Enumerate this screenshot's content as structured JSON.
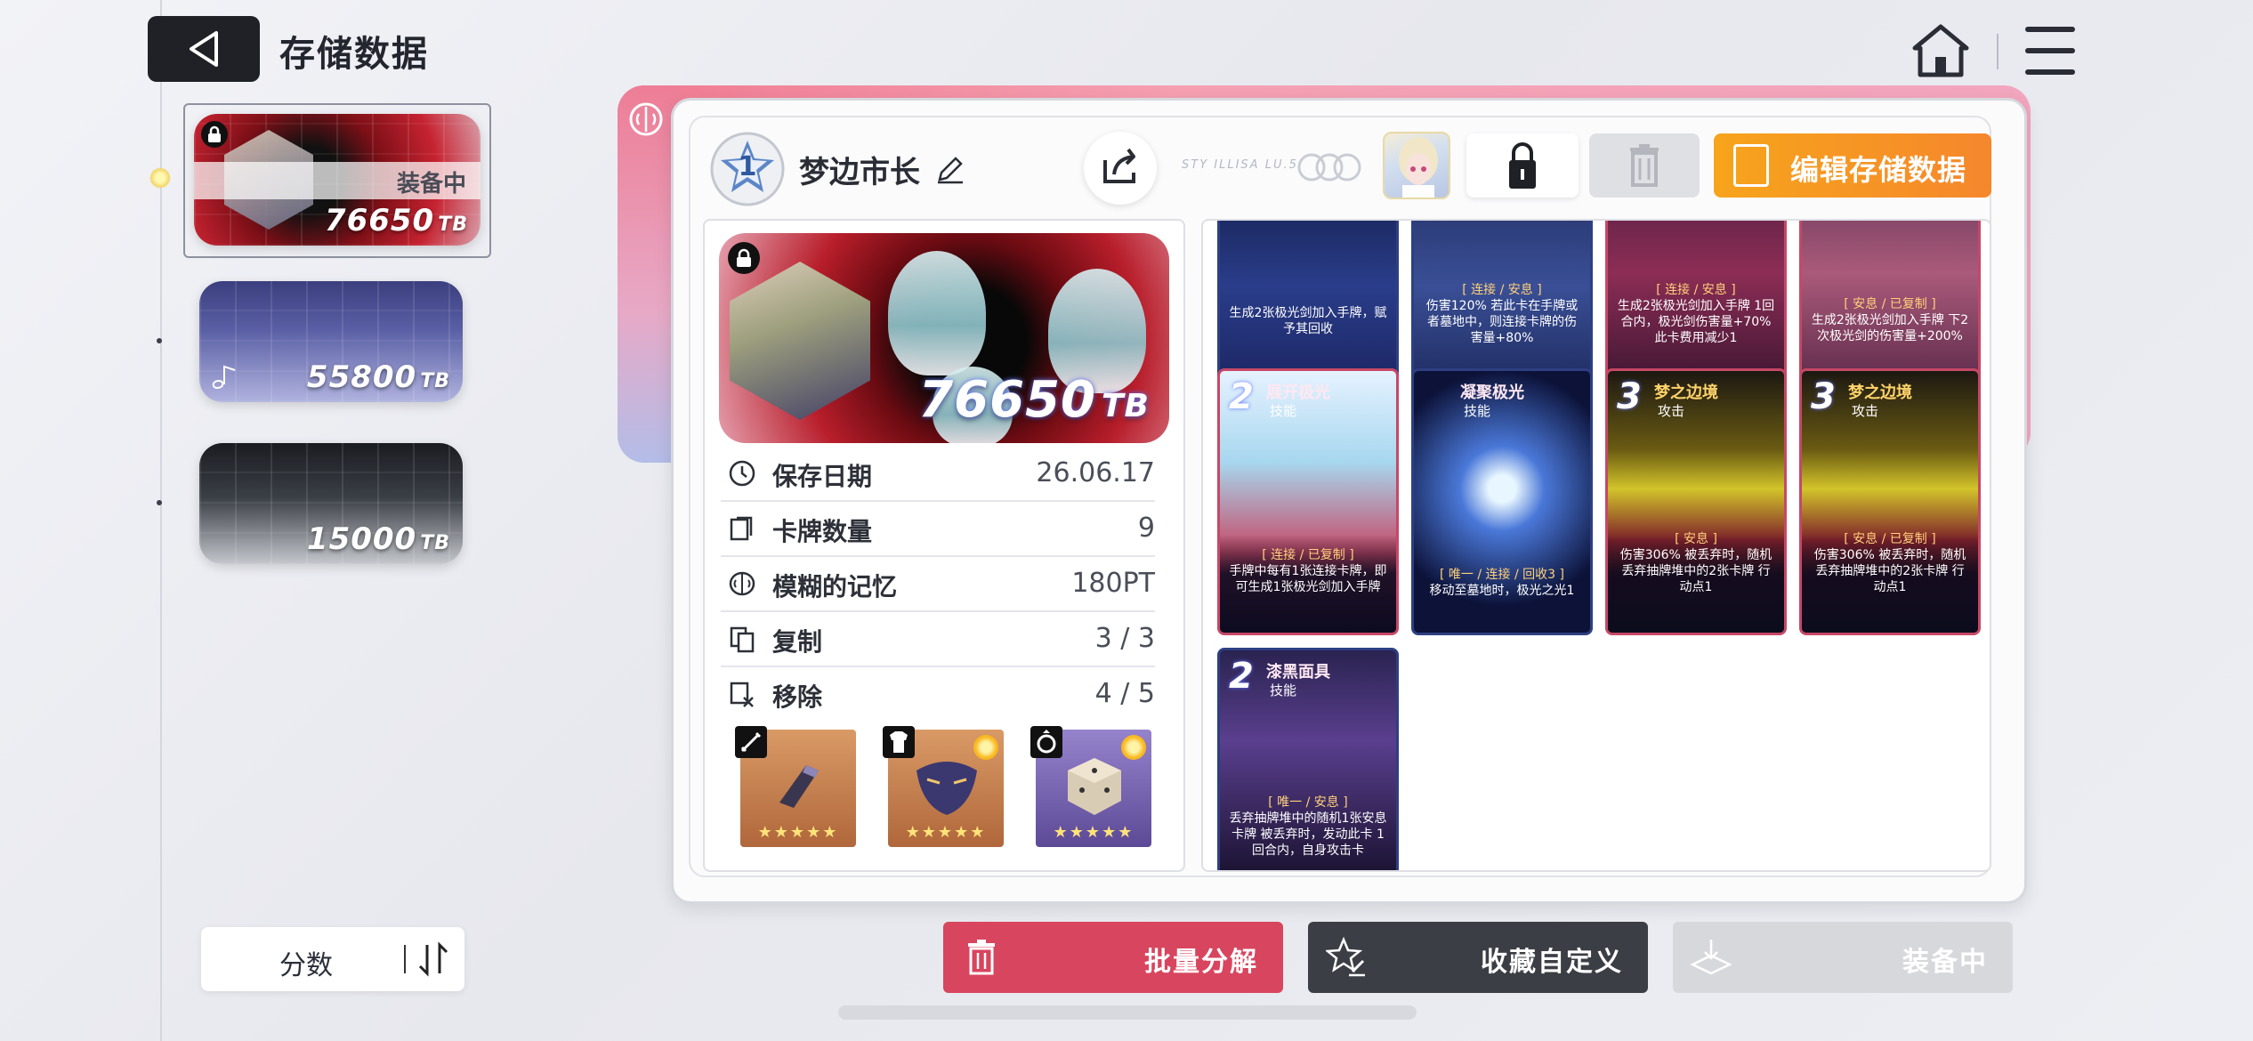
{
  "header": {
    "title": "存储数据",
    "back_icon": "back-triangle-icon",
    "home_icon": "home-icon",
    "menu_icon": "menu-icon"
  },
  "sidebar": {
    "slots": [
      {
        "value": "76650",
        "unit": "TB",
        "equipped_label": "装备中",
        "locked": true,
        "selected": true
      },
      {
        "value": "55800",
        "unit": "TB",
        "locked": false
      },
      {
        "value": "15000",
        "unit": "TB",
        "locked": false
      }
    ],
    "sort": {
      "label": "分数"
    }
  },
  "profile": {
    "level": "1",
    "name": "梦边市长",
    "serial": "STY ILLISA LU.5"
  },
  "toolbar": {
    "edit_save_label": "编辑存储数据"
  },
  "hero": {
    "value": "76650",
    "unit": "TB"
  },
  "stats": [
    {
      "label": "保存日期",
      "value": "26.06.17",
      "icon": "clock-icon"
    },
    {
      "label": "卡牌数量",
      "value": "9",
      "icon": "cards-icon"
    },
    {
      "label": "模糊的记忆",
      "value": "180PT",
      "icon": "brain-icon"
    },
    {
      "label": "复制",
      "value": "3 / 3",
      "icon": "copy-icon"
    },
    {
      "label": "移除",
      "value": "4 / 5",
      "icon": "remove-icon"
    }
  ],
  "equipment": [
    {
      "type": "sword-icon",
      "stars": "★★★★★",
      "rarity_color": "#c9804a",
      "special": false
    },
    {
      "type": "armor-icon",
      "stars": "★★★★★",
      "rarity_color": "#c9804a",
      "special": true
    },
    {
      "type": "ring-icon",
      "stars": "★★★★★",
      "rarity_color": "#6f5aa7",
      "special": true
    }
  ],
  "cards_top_row": [
    {
      "tag": "",
      "desc": "生成2张极光剑加入手牌，赋予其回收"
    },
    {
      "tag": "[ 连接 / 安息 ]",
      "desc": "伤害120% 若此卡在手牌或者墓地中，则连接卡牌的伤害量+80%"
    },
    {
      "tag": "[ 连接 / 安息 ]",
      "desc": "生成2张极光剑加入手牌 1回合内，极光剑伤害量+70% 此卡费用减少1"
    },
    {
      "tag": "[ 安息 / 已复制 ]",
      "desc": "生成2张极光剑加入手牌 下2次极光剑的伤害量+200%"
    }
  ],
  "cards": [
    {
      "cost": "2",
      "name": "展开极光",
      "type": "技能",
      "tag": "[ 连接 / 已复制 ]",
      "desc": "手牌中每有1张连接卡牌，即可生成1张极光剑加入手牌"
    },
    {
      "cost": "",
      "name": "凝聚极光",
      "type": "技能",
      "tag": "[ 唯一 / 连接 / 回收3 ]",
      "desc": "移动至墓地时，极光之光1"
    },
    {
      "cost": "3",
      "name": "梦之边境",
      "type": "攻击",
      "tag": "[ 安息 ]",
      "desc": "伤害306% 被丢弃时，随机丢弃抽牌堆中的2张卡牌 行动点1"
    },
    {
      "cost": "3",
      "name": "梦之边境",
      "type": "攻击",
      "tag": "[ 安息 / 已复制 ]",
      "desc": "伤害306% 被丢弃时，随机丢弃抽牌堆中的2张卡牌 行动点1"
    },
    {
      "cost": "2",
      "name": "漆黑面具",
      "type": "技能",
      "tag": "[ 唯一 / 安息 ]",
      "desc": "丢弃抽牌堆中的随机1张安息卡牌 被丢弃时，发动此卡 1回合内，自身攻击卡"
    }
  ],
  "actions": {
    "decompose_label": "批量分解",
    "collect_label": "收藏自定义",
    "equipped_label": "装备中"
  },
  "colors": {
    "accent_orange": "#f5932a",
    "danger_red": "#d8455e",
    "dark": "#1f2127"
  }
}
